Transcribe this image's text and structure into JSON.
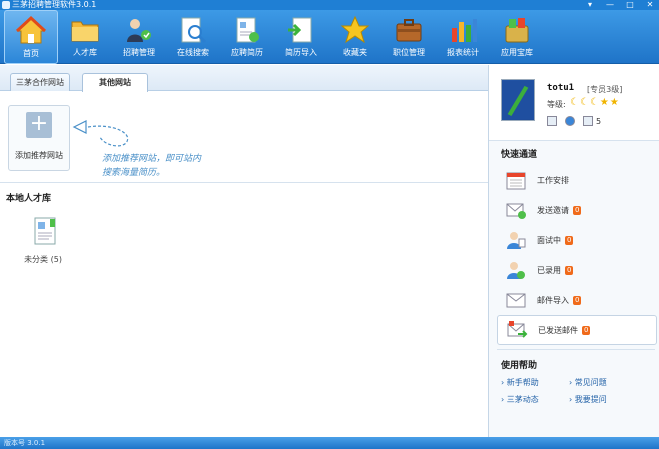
{
  "window": {
    "title": "三茅招聘管理软件3.0.1",
    "controls": [
      "▾",
      "—",
      "□",
      "✕"
    ]
  },
  "toolbar": {
    "items": [
      {
        "label": "首页",
        "icon": "home-icon",
        "active": true
      },
      {
        "label": "人才库",
        "icon": "folder-icon"
      },
      {
        "label": "招聘管理",
        "icon": "users-icon"
      },
      {
        "label": "在线搜索",
        "icon": "search-icon"
      },
      {
        "label": "应聘简历",
        "icon": "resume-icon"
      },
      {
        "label": "简历导入",
        "icon": "import-icon"
      },
      {
        "label": "收藏夹",
        "icon": "star-icon"
      },
      {
        "label": "职位管理",
        "icon": "briefcase-icon"
      },
      {
        "label": "报表统计",
        "icon": "chart-icon"
      },
      {
        "label": "应用宝库",
        "icon": "apps-icon"
      }
    ]
  },
  "tabs": [
    {
      "label": "三茅合作网站"
    },
    {
      "label": "其他网站",
      "selected": true
    }
  ],
  "add_site": {
    "label": "添加推荐网站",
    "hint_line1": "添加推荐网站，即可站内",
    "hint_line2": "搜索海量简历。"
  },
  "local_talent": {
    "title": "本地人才库",
    "folder_label": "未分类 (5)"
  },
  "user": {
    "name": "totu1",
    "member": "[专员3级]",
    "level_label": "等级:",
    "mail_count": "5"
  },
  "quick": {
    "title": "快速通道",
    "items": [
      {
        "label": "工作安排",
        "icon": "calendar-icon",
        "badge": ""
      },
      {
        "label": "发送邀请",
        "icon": "send-invite-icon",
        "badge": "0"
      },
      {
        "label": "面试中",
        "icon": "interview-icon",
        "badge": "0"
      },
      {
        "label": "已录用",
        "icon": "hired-icon",
        "badge": "0"
      },
      {
        "label": "邮件导入",
        "icon": "mail-import-icon",
        "badge": "0"
      },
      {
        "label": "已发送邮件",
        "icon": "sent-mail-icon",
        "badge": "0",
        "highlight": true
      }
    ]
  },
  "help": {
    "title": "使用帮助",
    "links": [
      "新手帮助",
      "常见问题",
      "三茅动态",
      "我要提问"
    ]
  },
  "status": {
    "version": "版本号 3.0.1"
  }
}
